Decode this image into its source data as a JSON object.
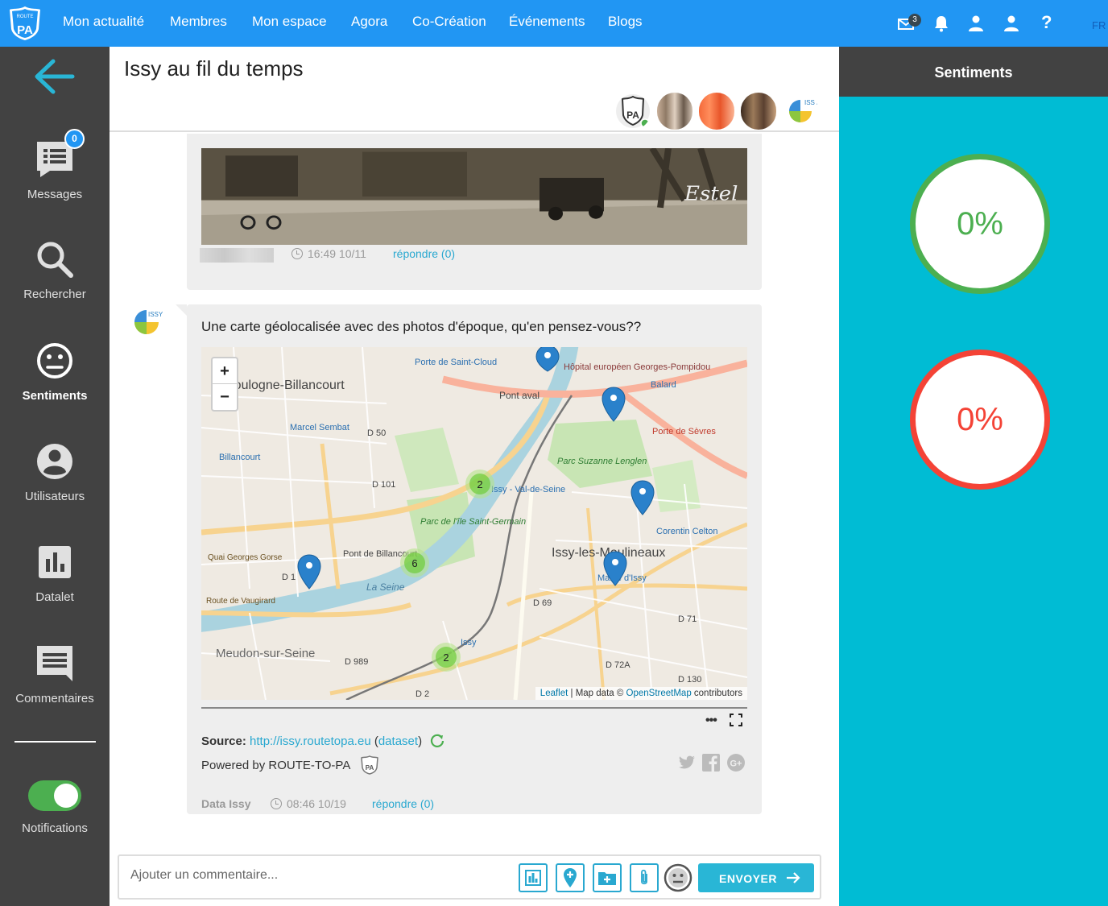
{
  "nav": {
    "links": [
      "Mon actualité",
      "Membres",
      "Mon espace",
      "Agora",
      "Co-Création",
      "Événements",
      "Blogs"
    ],
    "mail_badge": "3",
    "help": "?",
    "lang": "FR",
    "logo_text_top": "ROUTE TO",
    "logo_text_main": "PA"
  },
  "sidebar": {
    "messages_badge": "0",
    "items": {
      "messages": "Messages",
      "search": "Rechercher",
      "sentiments": "Sentiments",
      "users": "Utilisateurs",
      "datalet": "Datalet",
      "comments": "Commentaires"
    },
    "notifications": "Notifications"
  },
  "header": {
    "title": "Issy au fil du temps"
  },
  "post1": {
    "time": "16:49 10/11",
    "reply": "répondre (0)"
  },
  "post2": {
    "text": "Une carte géolocalisée avec des photos d'époque, qu'en pensez-vous??",
    "map": {
      "zoom_in": "+",
      "zoom_out": "−",
      "attribution_leaflet": "Leaflet",
      "attribution_mid": " | Map data © ",
      "attribution_osm": "OpenStreetMap",
      "attribution_end": " contributors",
      "places": [
        "Boulogne-Billancourt",
        "Issy-les-Moulineaux",
        "Meudon-sur-Seine",
        "Porte de Saint-Cloud",
        "Pont aval",
        "Hôpital européen Georges-Pompidou",
        "Balard",
        "Porte de Sèvres",
        "Marcel Sembat",
        "Billancourt",
        "Parc Suzanne Lenglen",
        "Issy - Val-de-Seine",
        "Corentin Celton",
        "Mairie d'Issy",
        "Pont de Billancourt",
        "Parc de l'île Saint-Germain",
        "La Seine",
        "Route de Vaugirard",
        "Quai Georges Gorse",
        "D 50",
        "D 101",
        "D 1",
        "D 69",
        "D 71",
        "D 72A",
        "D 989",
        "D 2",
        "D 130",
        "Issy"
      ],
      "clusters": [
        "2",
        "6",
        "2"
      ]
    },
    "source_label": "Source: ",
    "source_url": "http://issy.routetopa.eu",
    "dataset_open": " (",
    "dataset_link": "dataset",
    "dataset_close": ")",
    "powered": "Powered by ROUTE-TO-PA",
    "author": "Data Issy",
    "time": "08:46 10/19",
    "reply": "répondre (0)"
  },
  "comment": {
    "placeholder": "Ajouter un commentaire...",
    "send": "ENVOYER"
  },
  "right": {
    "title": "Sentiments",
    "positive": "0%",
    "negative": "0%"
  },
  "colors": {
    "nav": "#2196f3",
    "sidebar": "#424242",
    "accent": "#29a8d0",
    "panel": "#00bcd4",
    "positive": "#4caf50",
    "negative": "#f44336"
  }
}
